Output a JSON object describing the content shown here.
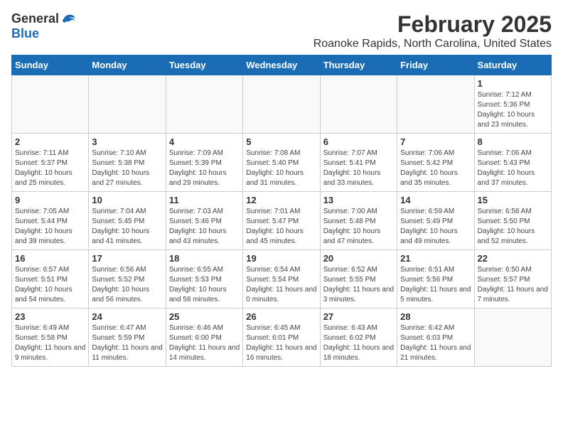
{
  "logo": {
    "general": "General",
    "blue": "Blue"
  },
  "header": {
    "title": "February 2025",
    "subtitle": "Roanoke Rapids, North Carolina, United States"
  },
  "weekdays": [
    "Sunday",
    "Monday",
    "Tuesday",
    "Wednesday",
    "Thursday",
    "Friday",
    "Saturday"
  ],
  "weeks": [
    [
      {
        "day": "",
        "info": ""
      },
      {
        "day": "",
        "info": ""
      },
      {
        "day": "",
        "info": ""
      },
      {
        "day": "",
        "info": ""
      },
      {
        "day": "",
        "info": ""
      },
      {
        "day": "",
        "info": ""
      },
      {
        "day": "1",
        "info": "Sunrise: 7:12 AM\nSunset: 5:36 PM\nDaylight: 10 hours and 23 minutes."
      }
    ],
    [
      {
        "day": "2",
        "info": "Sunrise: 7:11 AM\nSunset: 5:37 PM\nDaylight: 10 hours and 25 minutes."
      },
      {
        "day": "3",
        "info": "Sunrise: 7:10 AM\nSunset: 5:38 PM\nDaylight: 10 hours and 27 minutes."
      },
      {
        "day": "4",
        "info": "Sunrise: 7:09 AM\nSunset: 5:39 PM\nDaylight: 10 hours and 29 minutes."
      },
      {
        "day": "5",
        "info": "Sunrise: 7:08 AM\nSunset: 5:40 PM\nDaylight: 10 hours and 31 minutes."
      },
      {
        "day": "6",
        "info": "Sunrise: 7:07 AM\nSunset: 5:41 PM\nDaylight: 10 hours and 33 minutes."
      },
      {
        "day": "7",
        "info": "Sunrise: 7:06 AM\nSunset: 5:42 PM\nDaylight: 10 hours and 35 minutes."
      },
      {
        "day": "8",
        "info": "Sunrise: 7:06 AM\nSunset: 5:43 PM\nDaylight: 10 hours and 37 minutes."
      }
    ],
    [
      {
        "day": "9",
        "info": "Sunrise: 7:05 AM\nSunset: 5:44 PM\nDaylight: 10 hours and 39 minutes."
      },
      {
        "day": "10",
        "info": "Sunrise: 7:04 AM\nSunset: 5:45 PM\nDaylight: 10 hours and 41 minutes."
      },
      {
        "day": "11",
        "info": "Sunrise: 7:03 AM\nSunset: 5:46 PM\nDaylight: 10 hours and 43 minutes."
      },
      {
        "day": "12",
        "info": "Sunrise: 7:01 AM\nSunset: 5:47 PM\nDaylight: 10 hours and 45 minutes."
      },
      {
        "day": "13",
        "info": "Sunrise: 7:00 AM\nSunset: 5:48 PM\nDaylight: 10 hours and 47 minutes."
      },
      {
        "day": "14",
        "info": "Sunrise: 6:59 AM\nSunset: 5:49 PM\nDaylight: 10 hours and 49 minutes."
      },
      {
        "day": "15",
        "info": "Sunrise: 6:58 AM\nSunset: 5:50 PM\nDaylight: 10 hours and 52 minutes."
      }
    ],
    [
      {
        "day": "16",
        "info": "Sunrise: 6:57 AM\nSunset: 5:51 PM\nDaylight: 10 hours and 54 minutes."
      },
      {
        "day": "17",
        "info": "Sunrise: 6:56 AM\nSunset: 5:52 PM\nDaylight: 10 hours and 56 minutes."
      },
      {
        "day": "18",
        "info": "Sunrise: 6:55 AM\nSunset: 5:53 PM\nDaylight: 10 hours and 58 minutes."
      },
      {
        "day": "19",
        "info": "Sunrise: 6:54 AM\nSunset: 5:54 PM\nDaylight: 11 hours and 0 minutes."
      },
      {
        "day": "20",
        "info": "Sunrise: 6:52 AM\nSunset: 5:55 PM\nDaylight: 11 hours and 3 minutes."
      },
      {
        "day": "21",
        "info": "Sunrise: 6:51 AM\nSunset: 5:56 PM\nDaylight: 11 hours and 5 minutes."
      },
      {
        "day": "22",
        "info": "Sunrise: 6:50 AM\nSunset: 5:57 PM\nDaylight: 11 hours and 7 minutes."
      }
    ],
    [
      {
        "day": "23",
        "info": "Sunrise: 6:49 AM\nSunset: 5:58 PM\nDaylight: 11 hours and 9 minutes."
      },
      {
        "day": "24",
        "info": "Sunrise: 6:47 AM\nSunset: 5:59 PM\nDaylight: 11 hours and 11 minutes."
      },
      {
        "day": "25",
        "info": "Sunrise: 6:46 AM\nSunset: 6:00 PM\nDaylight: 11 hours and 14 minutes."
      },
      {
        "day": "26",
        "info": "Sunrise: 6:45 AM\nSunset: 6:01 PM\nDaylight: 11 hours and 16 minutes."
      },
      {
        "day": "27",
        "info": "Sunrise: 6:43 AM\nSunset: 6:02 PM\nDaylight: 11 hours and 18 minutes."
      },
      {
        "day": "28",
        "info": "Sunrise: 6:42 AM\nSunset: 6:03 PM\nDaylight: 11 hours and 21 minutes."
      },
      {
        "day": "",
        "info": ""
      }
    ]
  ]
}
